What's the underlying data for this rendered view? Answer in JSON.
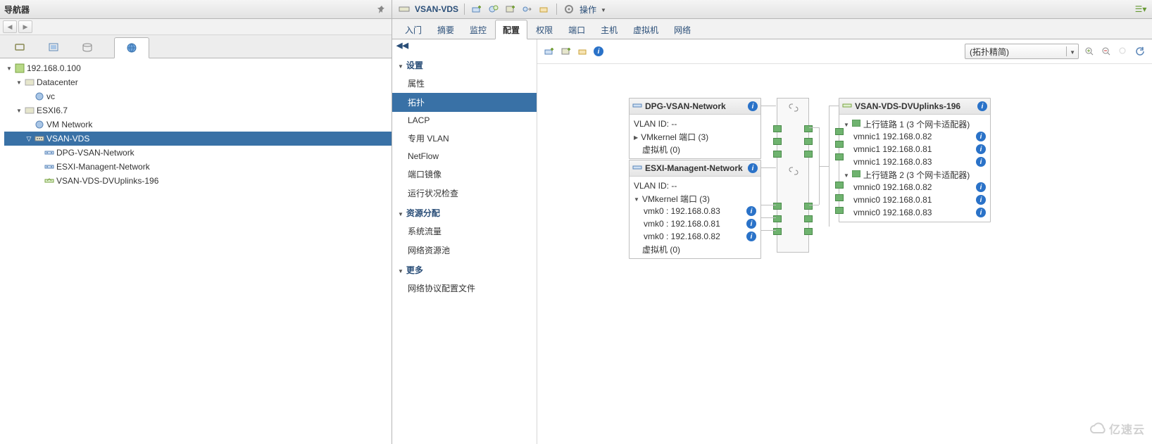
{
  "navigator": {
    "title": "导航器",
    "tree": {
      "root": "192.168.0.100",
      "datacenter": "Datacenter",
      "vc": "vc",
      "host": "ESXI6.7",
      "vmnet": "VM Network",
      "vds": "VSAN-VDS",
      "dpg": "DPG-VSAN-Network",
      "mgmt": "ESXI-Managent-Network",
      "uplinks": "VSAN-VDS-DVUplinks-196"
    }
  },
  "object": {
    "title": "VSAN-VDS",
    "actions_label": "操作"
  },
  "tabs": {
    "t0": "入门",
    "t1": "摘要",
    "t2": "监控",
    "t3": "配置",
    "t4": "权限",
    "t5": "端口",
    "t6": "主机",
    "t7": "虚拟机",
    "t8": "网络"
  },
  "cfg": {
    "g_settings": "设置",
    "i_props": "属性",
    "i_topo": "拓扑",
    "i_lacp": "LACP",
    "i_pvlan": "专用 VLAN",
    "i_netflow": "NetFlow",
    "i_mirror": "端口镜像",
    "i_health": "运行状况检查",
    "g_res": "资源分配",
    "i_sysflow": "系统流量",
    "i_netpool": "网络资源池",
    "g_more": "更多",
    "i_netprof": "网络协议配置文件"
  },
  "topology": {
    "select_label": "(拓扑精简)",
    "pg1": {
      "title": "DPG-VSAN-Network",
      "vlan": "VLAN ID: --",
      "vmk": "VMkernel 端口 (3)",
      "vm": "虚拟机 (0)"
    },
    "pg2": {
      "title": "ESXI-Managent-Network",
      "vlan": "VLAN ID: --",
      "vmk": "VMkernel 端口 (3)",
      "k0": "vmk0 : 192.168.0.83",
      "k1": "vmk0 : 192.168.0.81",
      "k2": "vmk0 : 192.168.0.82",
      "vm": "虚拟机 (0)"
    },
    "up": {
      "title": "VSAN-VDS-DVUplinks-196",
      "u1": "上行链路 1 (3 个网卡适配器)",
      "u1a": "vmnic1 192.168.0.82",
      "u1b": "vmnic1 192.168.0.81",
      "u1c": "vmnic1 192.168.0.83",
      "u2": "上行链路 2 (3 个网卡适配器)",
      "u2a": "vmnic0 192.168.0.82",
      "u2b": "vmnic0 192.168.0.81",
      "u2c": "vmnic0 192.168.0.83"
    }
  },
  "watermark": "亿速云"
}
